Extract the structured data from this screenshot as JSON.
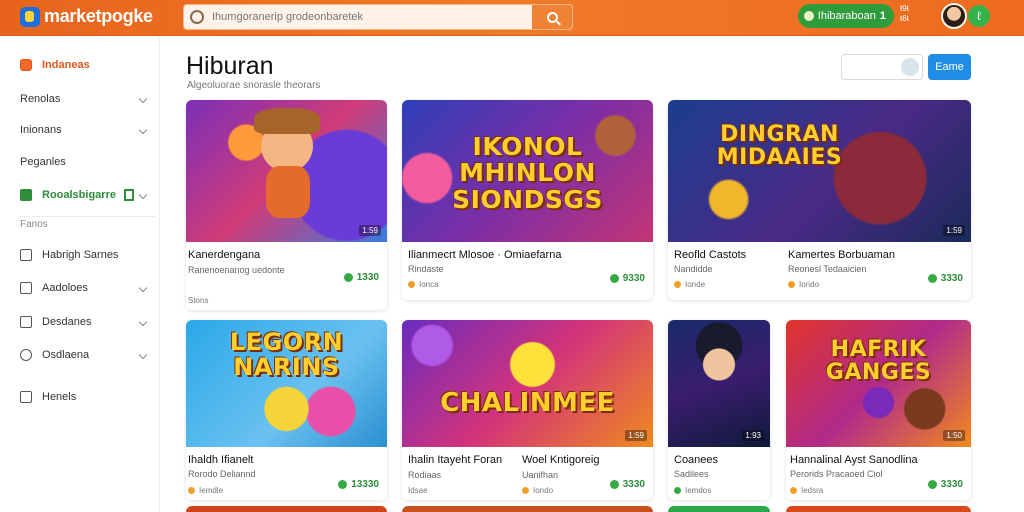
{
  "header": {
    "logo_text": "marketpogke",
    "search_placeholder": "Ihumgoranerip grodeonbaretek",
    "pill_label": "Ihibaraboan",
    "pill_count": "1",
    "mini_stat_1": "ŧ9ŧ",
    "mini_stat_2": "ŧ6ŧ",
    "bell_glyph": "ℓ"
  },
  "sidebar": {
    "items": [
      {
        "label": "Indaneas"
      },
      {
        "label": "Renolas"
      },
      {
        "label": "Inionans"
      },
      {
        "label": "Peganles"
      },
      {
        "label": "Rooalsbigarre"
      },
      {
        "label": "Habrigh Sarnes"
      },
      {
        "label": "Aadoloes"
      },
      {
        "label": "Desdanes"
      },
      {
        "label": "Osdlaena"
      },
      {
        "label": "Henels"
      }
    ],
    "section_label": "Fanos"
  },
  "main": {
    "title": "Hiburan",
    "subtitle": "Algeoluorae snorasle theorars",
    "filter_button": "Eame"
  },
  "cards": [
    {
      "art": "",
      "overlay": "1:59",
      "name": "Kanerdengana",
      "sub": "Ranenoenanog uedonte",
      "meta": "Stons",
      "price": "1330"
    },
    {
      "art": "IKONOL MHINLON SIONDSGS",
      "overlay": "",
      "name": "Ilianmecrt Mlosoe · Omiaefarna",
      "sub": "Rindaste",
      "meta": "Ionca",
      "price": "9330"
    },
    {
      "art": "DINGRAN MIDAAIES",
      "overlay": "1:59",
      "name": "Reofld Castots",
      "sub": "Nandidde",
      "meta": "Ionde",
      "price": "",
      "name2": "Kamertes Borbuaman",
      "sub2": "Reonesl Tedaaicien",
      "meta2": "Iondo",
      "price2": "3330"
    },
    {
      "art": "LEGORN NARINS",
      "overlay": "",
      "name": "Ihaldh Ifianelt",
      "sub": "Rorodo Deliannd",
      "meta": "Iemdle",
      "price": "13330"
    },
    {
      "art": "CHALINMEE",
      "overlay": "1:59",
      "name": "Ihalin Itayeht Foran",
      "sub": "Rodiaas",
      "meta": "Idsae",
      "price": "",
      "name2": "Woel Kntigoreig",
      "sub2": "Uanifhan",
      "meta2": "Iondo",
      "price2": "3330"
    },
    {
      "art": "",
      "overlay": "1:93",
      "name": "Coanees",
      "sub": "Sadilees",
      "meta": "Iemdos",
      "price": ""
    },
    {
      "art": "HAFRIK GANGES",
      "overlay": "1:50",
      "name": "Hannalinal Ayst Sanodlina",
      "sub": "Perorids Pracaoed Ciol",
      "meta": "Iedsra",
      "price": "3330"
    }
  ]
}
